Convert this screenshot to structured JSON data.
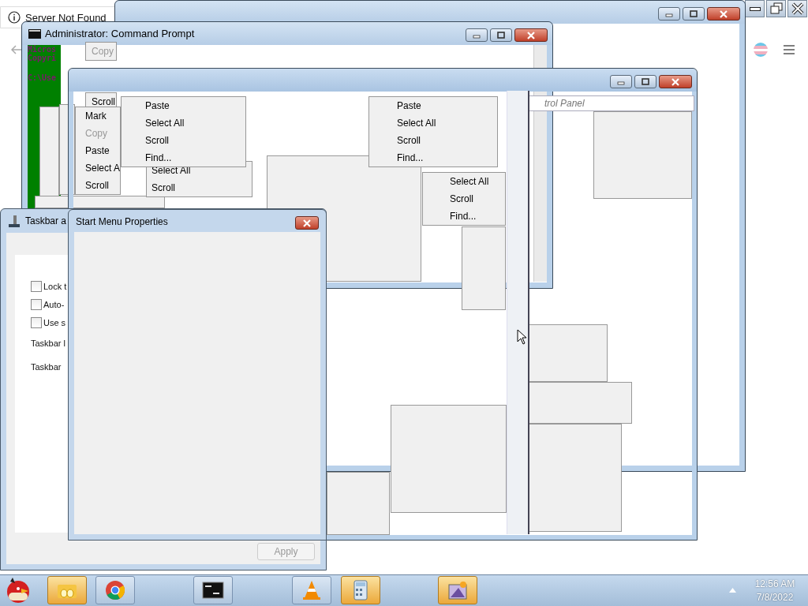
{
  "browser_window": {
    "notice": "Server Not Found"
  },
  "command_prompt": {
    "title": "Administrator: Command Prompt",
    "console_lines": [
      "Micros",
      "Copyri",
      "C:\\Use"
    ]
  },
  "context_menus": [
    {
      "items": [
        {
          "label": "Copy",
          "disabled": true
        }
      ]
    },
    {
      "items": [
        {
          "label": "Scroll",
          "disabled": false
        }
      ]
    },
    {
      "items": [
        {
          "label": "Mark",
          "disabled": false
        },
        {
          "label": "Copy",
          "disabled": true
        },
        {
          "label": "Paste",
          "disabled": false
        },
        {
          "label": "Select A",
          "disabled": false
        },
        {
          "label": "Scroll",
          "disabled": false
        }
      ]
    },
    {
      "items": [
        {
          "label": "Select All",
          "disabled": false
        },
        {
          "label": "Scroll",
          "disabled": false
        }
      ]
    },
    {
      "items": [
        {
          "label": "Select All",
          "disabled": false
        },
        {
          "label": "Scroll",
          "disabled": false
        },
        {
          "label": "Find...",
          "disabled": false
        }
      ]
    },
    {
      "items": [
        {
          "label": "Paste",
          "disabled": false
        },
        {
          "label": "Select All",
          "disabled": false
        },
        {
          "label": "Scroll",
          "disabled": false
        },
        {
          "label": "Find...",
          "disabled": false
        }
      ]
    },
    {
      "items": [
        {
          "label": "Paste",
          "disabled": false
        },
        {
          "label": "Select All",
          "disabled": false
        },
        {
          "label": "Scroll",
          "disabled": false
        },
        {
          "label": "Find...",
          "disabled": false
        }
      ]
    }
  ],
  "control_panel_window": {
    "address_fragment": "trol Panel"
  },
  "taskbar_properties": {
    "title": "Taskbar a",
    "options": [
      {
        "label": "Lock t",
        "checked": false
      },
      {
        "label": "Auto-",
        "checked": false
      },
      {
        "label": "Use s",
        "checked": false
      }
    ],
    "field_labels": [
      "Taskbar l",
      "Taskbar"
    ],
    "apply_button": {
      "label": "Apply",
      "disabled": true
    }
  },
  "start_menu_properties": {
    "title": "Start Menu Properties"
  },
  "taskbar": {
    "apps": [
      {
        "kind": "folder",
        "highlighted": true
      },
      {
        "kind": "chrome",
        "highlighted": false
      },
      {
        "kind": "console",
        "highlighted": false
      },
      {
        "kind": "cone",
        "highlighted": false
      },
      {
        "kind": "calculator",
        "highlighted": true
      },
      {
        "kind": "paint",
        "highlighted": true
      }
    ],
    "clock": {
      "time": "12:56 AM",
      "date": "7/8/2022"
    }
  }
}
